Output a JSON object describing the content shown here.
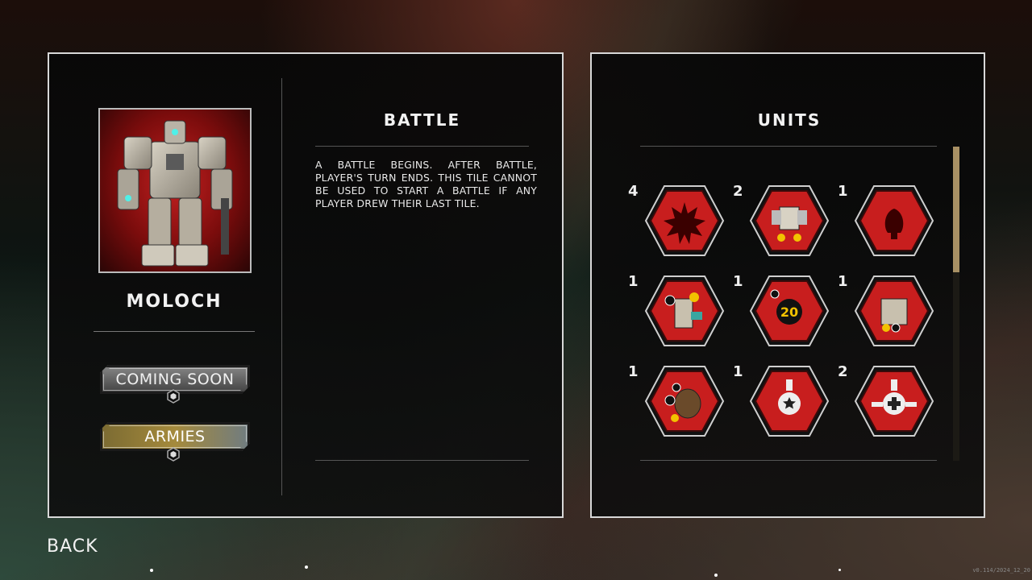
{
  "faction": {
    "name": "MOLOCH"
  },
  "buttons": {
    "coming_soon": "COMING SOON",
    "armies": "ARMIES"
  },
  "tile_detail": {
    "title": "BATTLE",
    "description": "A battle begins. After battle, player's turn ends. This tile cannot be used to start a battle if any player drew their last tile."
  },
  "units_panel": {
    "title": "UNITS",
    "units": [
      {
        "count": "4",
        "icon": "battle-tile-icon"
      },
      {
        "count": "2",
        "icon": "mech-unit-icon"
      },
      {
        "count": "1",
        "icon": "bomb-tile-icon"
      },
      {
        "count": "1",
        "icon": "soldier-unit-icon"
      },
      {
        "count": "1",
        "icon": "hq-tile-icon"
      },
      {
        "count": "1",
        "icon": "robot-unit-icon"
      },
      {
        "count": "1",
        "icon": "tank-unit-icon"
      },
      {
        "count": "1",
        "icon": "officer-module-icon"
      },
      {
        "count": "2",
        "icon": "medic-module-icon"
      }
    ]
  },
  "nav": {
    "back": "BACK"
  },
  "version": "v0.114/2024_12_20",
  "colors": {
    "tile_red": "#c81e1e",
    "armies_gold": "#a58a3c",
    "scroll_thumb": "#a89064"
  }
}
